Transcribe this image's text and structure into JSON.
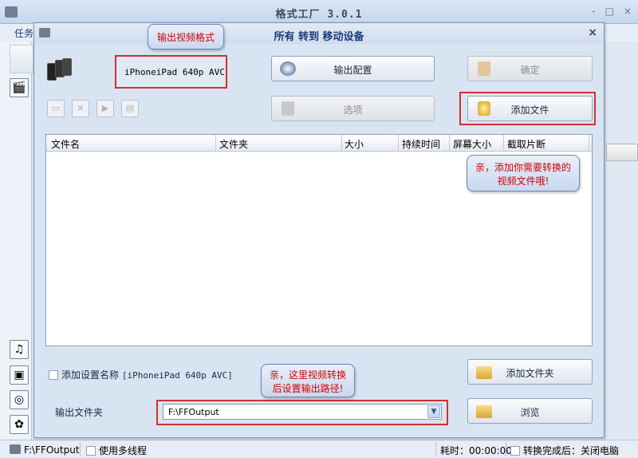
{
  "app": {
    "title": "格式工厂 3.0.1",
    "menu_item": "任务",
    "window_controls": [
      "-",
      "□",
      "×"
    ]
  },
  "dialog": {
    "title": "所有 转到 移动设备",
    "close": "×",
    "format_text": "iPhoneiPad 640p AVC",
    "buttons": {
      "output_config": "输出配置",
      "ok": "确定",
      "options": "选项",
      "add_file": "添加文件",
      "add_folder": "添加文件夹",
      "browse": "浏览"
    },
    "table_headers": [
      "文件名",
      "文件夹",
      "大小",
      "持续时间",
      "屏幕大小",
      "截取片断"
    ],
    "tooltips": {
      "format": "输出视频格式",
      "add_file": "亲，添加你需要转换的视频文件哦!",
      "output_path": "亲，这里视频转换后设置输出路径!"
    },
    "footer": {
      "add_setting_name": "添加设置名称",
      "setting_value": "[iPhoneiPad 640p AVC]",
      "output_folder_label": "输出文件夹",
      "output_folder_value": "F:\\FFOutput"
    }
  },
  "statusbar": {
    "path": "F:\\FFOutput",
    "multithread": "使用多线程",
    "elapsed": "耗时：00:00:00",
    "after_done": "转换完成后：关闭电脑"
  },
  "icons": [
    "app-icon",
    "dialog-icon",
    "phones-icon",
    "gear-icon",
    "film-icon",
    "add-file-icon",
    "folder-add-icon",
    "folder-browse-icon",
    "arrow-icon"
  ]
}
